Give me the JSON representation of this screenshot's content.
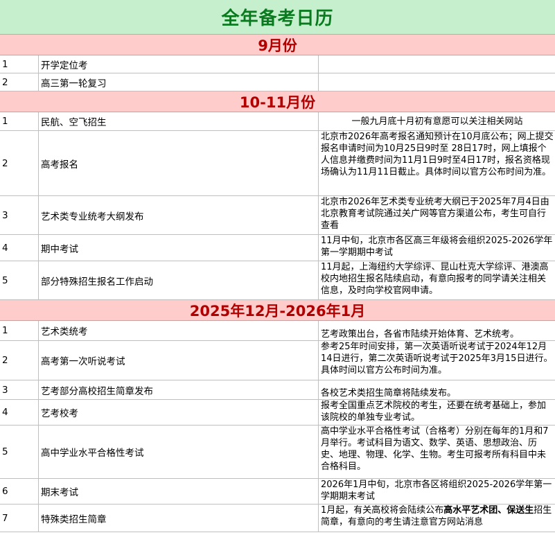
{
  "title": "全年备考日历",
  "sections": [
    {
      "heading": "9月份",
      "rows": [
        {
          "num": "1",
          "name": "开学定位考",
          "note": ""
        },
        {
          "num": "2",
          "name": "高三第一轮复习",
          "note": ""
        }
      ]
    },
    {
      "heading": "10-11月份",
      "rows": [
        {
          "num": "1",
          "name": "民航、空飞招生",
          "note": "一般九月底十月初有意愿可以关注相关网站"
        },
        {
          "num": "2",
          "name": "高考报名",
          "note": "北京市2026年高考报名通知预计在10月底公布；网上提交报名申请时间为10月25日9时至 28日17时，网上填报个人信息并缴费时间为11月1日9时至4日17时，报名资格现场确认为11月11日截止。具体时间以官方公布时间为准。"
        },
        {
          "num": "3",
          "name": "艺术类专业统考大纲发布",
          "note": "北京市2026年艺术类专业统考大纲已于2025年7月4日由北京教育考试院通过关广网等官方渠道公布，考生可自行查看"
        },
        {
          "num": "4",
          "name": "期中考试",
          "note": "11月中旬，北京市各区高三年级将会组织2025-2026学年第一学期期中考试"
        },
        {
          "num": "5",
          "name": "部分特殊招生报名工作启动",
          "note": "11月起，上海纽约大学综评、昆山杜克大学综评、港澳高校内地招生报名陆续启动，有意向报考的同学请关注相关信息，及时向学校官网申请。"
        }
      ]
    },
    {
      "heading": "2025年12月-2026年1月",
      "rows": [
        {
          "num": "1",
          "name": "艺术类统考",
          "note": "艺考政策出台，各省市陆续开始体育、艺术统考。"
        },
        {
          "num": "2",
          "name": "高考第一次听说考试",
          "note": "参考25年时间安排，第一次英语听说考试于2024年12月14日进行，第二次英语听说考试于2025年3月15日进行。具体时间以官方公布时间为准。"
        },
        {
          "num": "3",
          "name": "艺考部分高校招生简章发布",
          "note": "各校艺术类招生简章将陆续发布。"
        },
        {
          "num": "4",
          "name": "艺考校考",
          "note": "报考全国重点艺术院校的考生，还要在统考基础上，参加该院校的单独专业考试。"
        },
        {
          "num": "5",
          "name": "高中学业水平合格性考试",
          "note": "高中学业水平合格性考试（合格考）分别在每年的1月和7月举行。考试科目为语文、数学、英语、思想政治、历史、地理、物理、化学、生物。考生可报考所有科目中未合格科目。"
        },
        {
          "num": "6",
          "name": "期末考试",
          "note": "2026年1月中旬，北京市各区将组织2025-2026学年第一学期期末考试"
        },
        {
          "num": "7",
          "name": "特殊类招生简章",
          "note_parts": [
            "1月起，有关高校将会陆续公布",
            "高水平艺术团、保送生",
            "招生简章，有意向的考生请注意官方网站消息"
          ]
        }
      ]
    }
  ]
}
